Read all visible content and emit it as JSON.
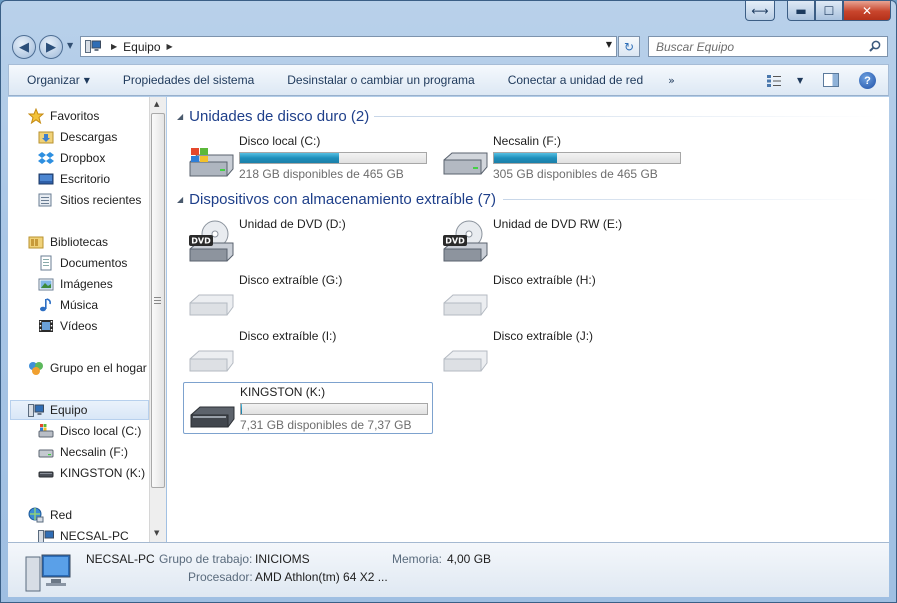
{
  "window": {
    "caption_buttons": {
      "alt": "⟷",
      "minimize": "▬",
      "maximize": "☐",
      "close": "✕"
    }
  },
  "nav": {
    "back_glyph": "◀",
    "forward_glyph": "▶",
    "breadcrumb": [
      "Equipo"
    ],
    "refresh_glyph": "↻"
  },
  "search": {
    "placeholder": "Buscar Equipo"
  },
  "commands": [
    {
      "label": "Organizar",
      "dropdown": true
    },
    {
      "label": "Propiedades del sistema"
    },
    {
      "label": "Desinstalar o cambiar un programa"
    },
    {
      "label": "Conectar a unidad de red"
    }
  ],
  "more_glyph": "»",
  "help_glyph": "?",
  "navpane": {
    "favorites": {
      "label": "Favoritos",
      "items": [
        "Descargas",
        "Dropbox",
        "Escritorio",
        "Sitios recientes"
      ]
    },
    "libraries": {
      "label": "Bibliotecas",
      "items": [
        "Documentos",
        "Imágenes",
        "Música",
        "Vídeos"
      ]
    },
    "homegroup": {
      "label": "Grupo en el hogar"
    },
    "computer": {
      "label": "Equipo",
      "items": [
        "Disco local (C:)",
        "Necsalin (F:)",
        "KINGSTON (K:)"
      ]
    },
    "network": {
      "label": "Red",
      "items": [
        "NECSAL-PC"
      ]
    }
  },
  "groups": {
    "hard_disks": {
      "title": "Unidades de disco duro (2)",
      "drives": [
        {
          "name": "Disco local (C:)",
          "free": "218 GB disponibles de 465 GB",
          "used_fraction": 0.53,
          "icon": "windows-drive-icon"
        },
        {
          "name": "Necsalin (F:)",
          "free": "305 GB disponibles de 465 GB",
          "used_fraction": 0.34,
          "icon": "hard-drive-icon"
        }
      ]
    },
    "removable": {
      "title": "Dispositivos con almacenamiento extraíble (7)",
      "drives": [
        {
          "name": "Unidad de DVD (D:)",
          "icon": "dvd-drive-icon",
          "badge": "DVD"
        },
        {
          "name": "Unidad de DVD RW (E:)",
          "icon": "dvd-drive-icon",
          "badge": "DVD"
        },
        {
          "name": "Disco extraíble (G:)",
          "icon": "removable-drive-icon"
        },
        {
          "name": "Disco extraíble (H:)",
          "icon": "removable-drive-icon"
        },
        {
          "name": "Disco extraíble (I:)",
          "icon": "removable-drive-icon"
        },
        {
          "name": "Disco extraíble (J:)",
          "icon": "removable-drive-icon"
        },
        {
          "name": "KINGSTON (K:)",
          "free": "7,31 GB disponibles de 7,37 GB",
          "used_fraction": 0.008,
          "icon": "usb-drive-icon"
        }
      ]
    }
  },
  "details": {
    "name": "NECSAL-PC",
    "workgroup_label": "Grupo de trabajo:",
    "workgroup_value": "INICIOMS",
    "memory_label": "Memoria:",
    "memory_value": "4,00 GB",
    "processor_label": "Procesador:",
    "processor_value": "AMD Athlon(tm) 64 X2 ..."
  },
  "colors": {
    "accent": "#1e3f8a",
    "bar_fill": "#1f8fbb",
    "selection": "#d9e7f7"
  }
}
